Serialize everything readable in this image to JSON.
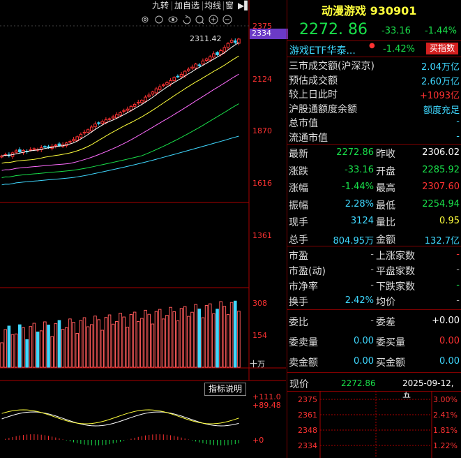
{
  "toolbar": {
    "items": [
      "九转",
      "加自选",
      "均线",
      "窗"
    ],
    "icons": [
      "gear-icon",
      "eye-icon",
      "undo-icon",
      "plus-icon",
      "minus-icon"
    ]
  },
  "chart": {
    "price_axis": [
      "2375",
      "2334",
      "2124",
      "1870",
      "1616",
      "1361"
    ],
    "high_label": "2311.42",
    "volume_axis": [
      "308",
      "154",
      "十万"
    ],
    "indicator_button": "指标说明",
    "macd_axis": [
      "+111.0",
      "+89.48",
      "+0"
    ]
  },
  "chart_data": {
    "type": "candlestick",
    "closes": [
      1745,
      1752,
      1748,
      1760,
      1770,
      1765,
      1772,
      1768,
      1775,
      1780,
      1776,
      1785,
      1790,
      1788,
      1792,
      1798,
      1795,
      1800,
      1808,
      1815,
      1825,
      1838,
      1850,
      1860,
      1872,
      1885,
      1900,
      1905,
      1912,
      1920,
      1925,
      1935,
      1945,
      1955,
      1965,
      1972,
      1985,
      1995,
      2005,
      2015,
      2030,
      2040,
      2055,
      2070,
      2080,
      2090,
      2100,
      2110,
      2125,
      2130,
      2140,
      2155,
      2165,
      2175,
      2190,
      2185,
      2205,
      2215,
      2225,
      2240,
      2235,
      2255,
      2270,
      2290,
      2305,
      2295,
      2311
    ]
  },
  "header": {
    "title": "动漫游戏 930901",
    "price": "2272. 86",
    "change": "-33.16",
    "change_pct": "-1.44%"
  },
  "etf": {
    "name": "游戏ETF华泰...",
    "pct": "-1.42%",
    "button": "买指数"
  },
  "market_rows": [
    {
      "label": "三市成交额(沪深京)",
      "value": "2.04万亿"
    },
    {
      "label": "预估成交额",
      "value": "2.60万亿"
    },
    {
      "label": "较上日此时",
      "value": "+1093亿"
    },
    {
      "label": "沪股通额度余额",
      "value": "额度充足"
    },
    {
      "label": "总市值",
      "value": "-"
    },
    {
      "label": "流通市值",
      "value": "-"
    }
  ],
  "quote_rows": [
    {
      "l1": "最新",
      "v1": "2272.86",
      "l2": "昨收",
      "v2": "2306.02"
    },
    {
      "l1": "涨跌",
      "v1": "-33.16",
      "l2": "开盘",
      "v2": "2285.92"
    },
    {
      "l1": "涨幅",
      "v1": "-1.44%",
      "l2": "最高",
      "v2": "2307.60"
    },
    {
      "l1": "振幅",
      "v1": "2.28%",
      "l2": "最低",
      "v2": "2254.94"
    },
    {
      "l1": "现手",
      "v1": "3124",
      "l2": "量比",
      "v2": "0.95"
    },
    {
      "l1": "总手",
      "v1": "804.95万",
      "l2": "金额",
      "v2": "132.7亿"
    }
  ],
  "stat_rows": [
    {
      "l1": "市盈",
      "v1": "-",
      "l2": "上涨家数",
      "v2": "-"
    },
    {
      "l1": "市盈(动)",
      "v1": "-",
      "l2": "平盘家数",
      "v2": "-"
    },
    {
      "l1": "市净率",
      "v1": "-",
      "l2": "下跌家数",
      "v2": "-"
    },
    {
      "l1": "换手",
      "v1": "2.42%",
      "l2": "均价",
      "v2": "-"
    }
  ],
  "order_rows": [
    {
      "l1": "委比",
      "v1": "-",
      "l2": "委差",
      "v2": "+0.00"
    },
    {
      "l1": "委卖量",
      "v1": "0.00",
      "l2": "委买量",
      "v2": "0.00"
    },
    {
      "l1": "卖金额",
      "v1": "0.00",
      "l2": "买金额",
      "v2": "0.00"
    }
  ],
  "mini": {
    "label": "现价",
    "price": "2272.86",
    "date": "2025-09-12,五",
    "left_axis": [
      "2375",
      "2361",
      "2348",
      "2334"
    ],
    "right_axis": [
      "3.00%",
      "2.41%",
      "1.81%",
      "1.22%"
    ]
  }
}
